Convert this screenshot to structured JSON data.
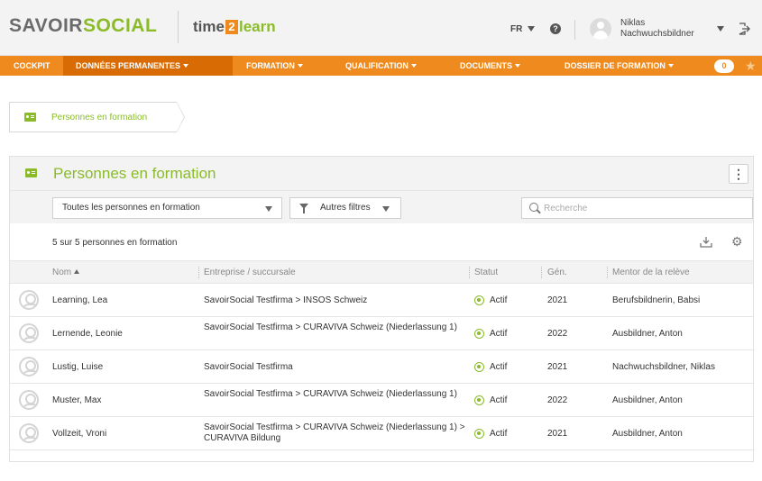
{
  "header": {
    "logo_part1": "SAVOIR",
    "logo_part2": "SOCIAL",
    "logo2_time": "time",
    "logo2_two": "2",
    "logo2_learn": "learn",
    "language": "FR",
    "help_glyph": "?",
    "user_first": "Niklas",
    "user_last": "Nachwuchsbildner"
  },
  "nav": {
    "items": [
      {
        "label": "COCKPIT"
      },
      {
        "label": "DONNÉES PERMANENTES"
      },
      {
        "label": "FORMATION"
      },
      {
        "label": "QUALIFICATION"
      },
      {
        "label": "DOCUMENTS"
      },
      {
        "label": "DOSSIER DE FORMATION"
      }
    ],
    "badge": "0",
    "accent_color": "#ef8b1e",
    "active_color": "#d96b05"
  },
  "breadcrumb": {
    "label": "Personnes en formation"
  },
  "panel": {
    "title": "Personnes en formation",
    "menu_glyph": "⋮",
    "brand_color": "#8bbb2b"
  },
  "filters": {
    "select_value": "Toutes les personnes en formation",
    "more_filters": "Autres filtres",
    "search_placeholder": "Recherche"
  },
  "summary": {
    "count_text": "5 sur 5 personnes en formation"
  },
  "table": {
    "headers": {
      "name": "Nom",
      "company": "Entreprise / succursale",
      "status": "Statut",
      "year": "Gén.",
      "mentor": "Mentor de la relève"
    },
    "rows": [
      {
        "name": "Learning, Lea",
        "company": "SavoirSocial Testfirma > INSOS Schweiz",
        "status": "Actif",
        "year": "2021",
        "mentor": "Berufsbildnerin, Babsi"
      },
      {
        "name": "Lernende, Leonie",
        "company": "SavoirSocial Testfirma > CURAVIVA Schweiz (Niederlassung 1)",
        "status": "Actif",
        "year": "2022",
        "mentor": "Ausbildner, Anton"
      },
      {
        "name": "Lustig, Luise",
        "company": "SavoirSocial Testfirma",
        "status": "Actif",
        "year": "2021",
        "mentor": "Nachwuchsbildner, Niklas"
      },
      {
        "name": "Muster, Max",
        "company": "SavoirSocial Testfirma > CURAVIVA Schweiz (Niederlassung 1)",
        "status": "Actif",
        "year": "2022",
        "mentor": "Ausbildner, Anton"
      },
      {
        "name": "Vollzeit, Vroni",
        "company": "SavoirSocial Testfirma > CURAVIVA Schweiz (Niederlassung 1) > CURAVIVA Bildung",
        "status": "Actif",
        "year": "2021",
        "mentor": "Ausbildner, Anton"
      }
    ]
  },
  "icons": {
    "help": "help-icon",
    "logout": "logout-icon",
    "breadcrumb": "id-card-icon",
    "filter": "filter-icon",
    "search": "search-icon",
    "export": "export-icon",
    "settings": "gear-icon",
    "avatar": "user-avatar-icon",
    "star": "star-icon"
  }
}
